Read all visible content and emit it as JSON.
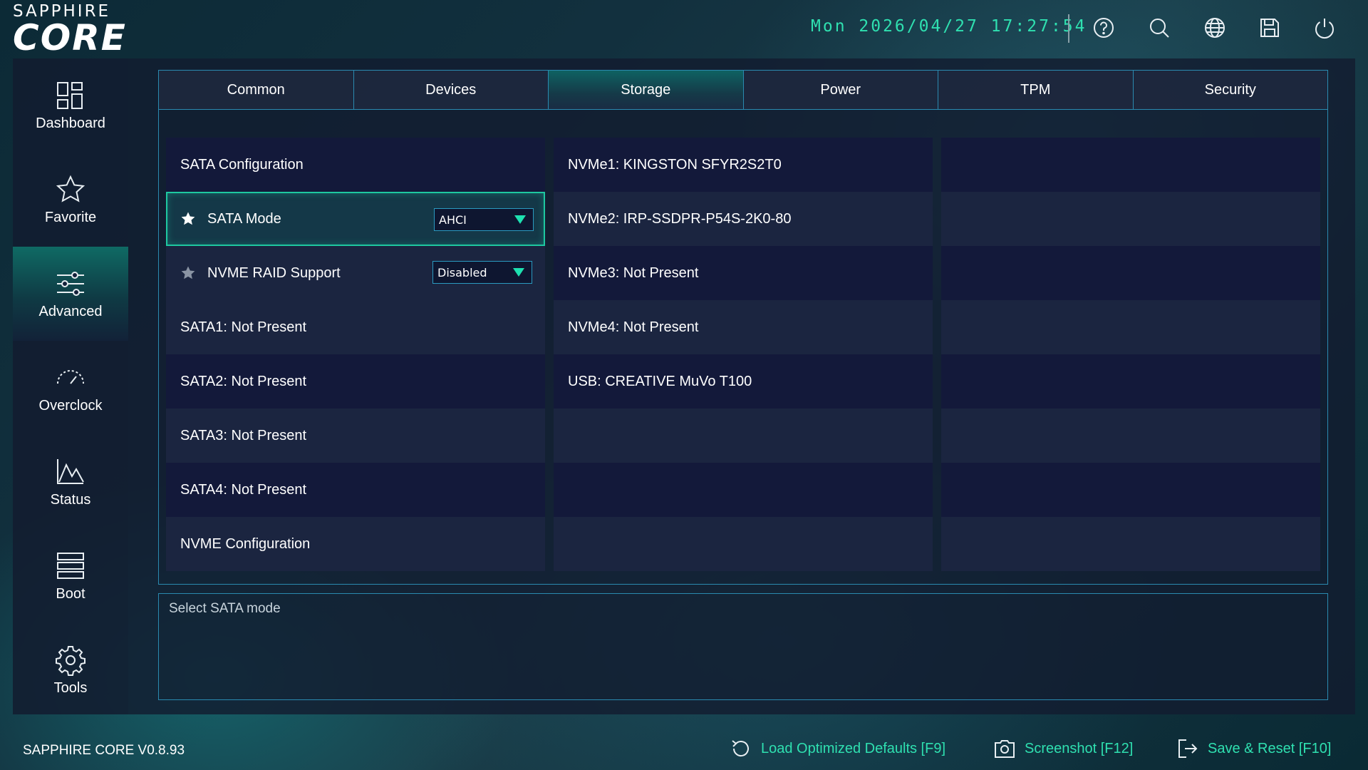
{
  "brand": {
    "top": "SAPPHIRE",
    "main": "CORE"
  },
  "header": {
    "datetime": "Mon 2026/04/27 17:27:54",
    "icons": [
      "help-icon",
      "search-icon",
      "globe-icon",
      "save-icon",
      "power-icon"
    ]
  },
  "sidebar": {
    "items": [
      {
        "label": "Dashboard",
        "icon": "dashboard-icon"
      },
      {
        "label": "Favorite",
        "icon": "star-icon"
      },
      {
        "label": "Advanced",
        "icon": "sliders-icon",
        "active": true
      },
      {
        "label": "Overclock",
        "icon": "gauge-icon"
      },
      {
        "label": "Status",
        "icon": "chart-icon"
      },
      {
        "label": "Boot",
        "icon": "boot-icon"
      },
      {
        "label": "Tools",
        "icon": "gear-icon"
      }
    ]
  },
  "tabs": [
    {
      "label": "Common"
    },
    {
      "label": "Devices"
    },
    {
      "label": "Storage",
      "active": true
    },
    {
      "label": "Power"
    },
    {
      "label": "TPM"
    },
    {
      "label": "Security"
    }
  ],
  "storage": {
    "left": [
      {
        "label": "SATA Configuration"
      },
      {
        "label": "SATA Mode",
        "value": "AHCI",
        "favorite": true
      },
      {
        "label": "NVME RAID Support",
        "value": "Disabled",
        "favorite": false
      },
      {
        "label": "SATA1: Not Present"
      },
      {
        "label": "SATA2: Not Present"
      },
      {
        "label": "SATA3: Not Present"
      },
      {
        "label": "SATA4: Not Present"
      },
      {
        "label": "NVME Configuration"
      }
    ],
    "middle": [
      {
        "label": "NVMe1: KINGSTON SFYR2S2T0"
      },
      {
        "label": "NVMe2: IRP-SSDPR-P54S-2K0-80"
      },
      {
        "label": "NVMe3: Not Present"
      },
      {
        "label": "NVMe4: Not Present"
      },
      {
        "label": "USB: CREATIVE MuVo T100"
      },
      {
        "label": ""
      },
      {
        "label": ""
      },
      {
        "label": ""
      }
    ]
  },
  "description": "Select SATA mode",
  "footer": {
    "version": "SAPPHIRE CORE V0.8.93",
    "load_defaults": "Load Optimized Defaults [F9]",
    "screenshot": "Screenshot [F12]",
    "save_reset": "Save & Reset [F10]"
  },
  "colors": {
    "accent": "#2fe0b0",
    "border": "#2a8ab0",
    "panel": "#13193a"
  }
}
